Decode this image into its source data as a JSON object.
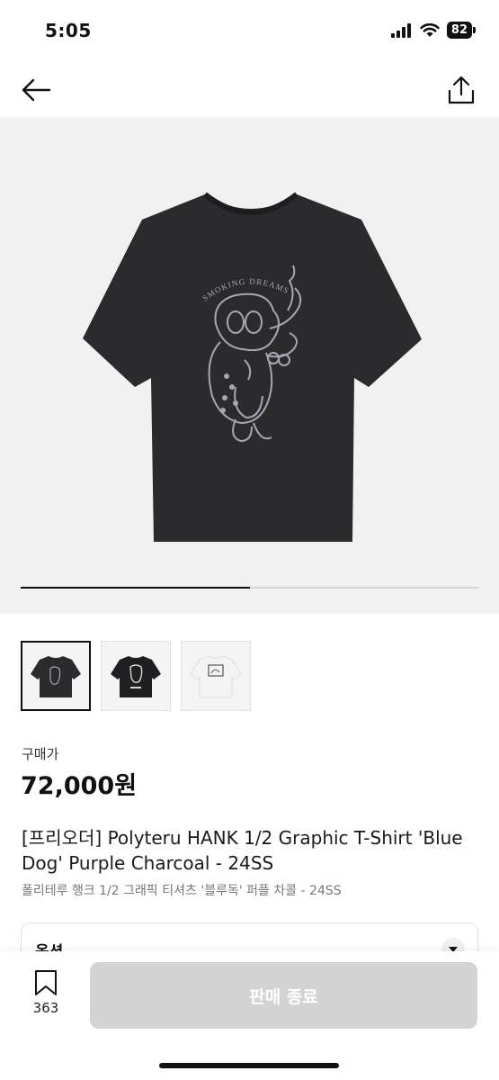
{
  "status_bar": {
    "time": "5:05",
    "battery": "82",
    "icons": [
      "signal-icon",
      "wifi-icon",
      "battery-icon"
    ]
  },
  "nav": {
    "icons": [
      "back-arrow-icon",
      "share-icon"
    ]
  },
  "gallery": {
    "image_count": 3,
    "current_index": 1,
    "progress": 0.5,
    "graphic_text": "SMOKING DREAMS",
    "colors": {
      "background": "#f1f1f1",
      "shirt": "#2b2a2c",
      "print": "#9a98a6"
    }
  },
  "price": {
    "label": "구매가",
    "value": "72,000원"
  },
  "product": {
    "title": "[프리오더] Polyteru HANK 1/2 Graphic T-Shirt 'Blue Dog' Purple Charcoal - 24SS",
    "subtitle": "폴리테루 행크 1/2 그래픽 티셔츠 '블루독' 퍼플 차콜 - 24SS"
  },
  "options": {
    "label": "옵션",
    "icon": "chevron-down-icon"
  },
  "bottom": {
    "bookmark_count": "363",
    "sold_out_label": "판매 종료",
    "colors": {
      "button": "#d3d3d3"
    }
  }
}
